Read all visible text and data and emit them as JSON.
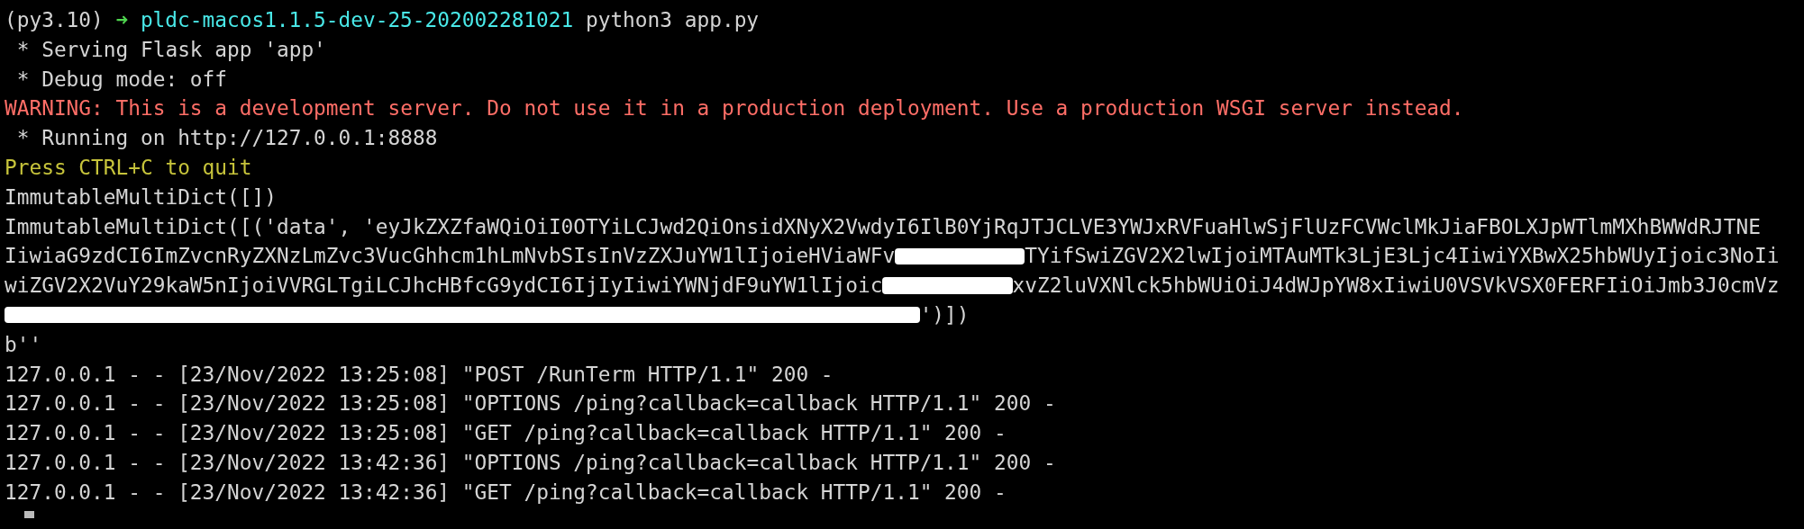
{
  "prompt": {
    "env": "(py3.10)",
    "arrow": "➜",
    "directory": "pldc-macos1.1.5-dev-25-202002281021",
    "command": "python3 app.py"
  },
  "lines": [
    {
      "kind": "info",
      "text": " * Serving Flask app 'app'"
    },
    {
      "kind": "info",
      "text": " * Debug mode: off"
    },
    {
      "kind": "warning",
      "text": "WARNING: This is a development server. Do not use it in a production deployment. Use a production WSGI server instead."
    },
    {
      "kind": "info",
      "text": " * Running on http://127.0.0.1:8888"
    },
    {
      "kind": "notice",
      "text": "Press CTRL+C to quit"
    },
    {
      "kind": "info",
      "text": "ImmutableMultiDict([])"
    },
    {
      "kind": "data",
      "segments": [
        {
          "text": "ImmutableMultiDict([('data', 'eyJkZXZfaWQiOiI0OTYiLCJwd2QiOnsidXNyX2VwdyI6IlB0YjRqJTJCLVE3YWJxRVFuaHlwSjFlUzFCVWclMkJiaFBOLXJpWTlmMXhBWWdRJTNE",
          "redacted_before": false
        }
      ]
    },
    {
      "kind": "data",
      "segments": [
        {
          "text": "IiwiaG9zdCI6ImZvcnRyZXNzLmZvc3VucGhhcm1hLmNvbSIsInVzZXJuYW1lIjoieHViaWFv",
          "redacted_before": false
        },
        {
          "text": "TYifSwiZGV2X2lwIjoiMTAuMTk3LjE3Ljc4IiwiYXBwX25hbWUyIjoic3NoIi",
          "redacted_before": true
        }
      ]
    },
    {
      "kind": "data",
      "segments": [
        {
          "text": "wiZGV2X2VuY29kaW5nIjoiVVRGLTgiLCJhcHBfcG9ydCI6IjIyIiwiYWNjdF9uYW1lIjoic",
          "redacted_before": false
        },
        {
          "text": "xvZ2luVXNlck5hbWUiOiJ4dWJpYW8xIiwiU0VSVkVSX0FERFIiOiJmb3J0cmVz",
          "redacted_before": true
        }
      ]
    },
    {
      "kind": "data",
      "segments": [
        {
          "text": "')])",
          "redacted_before": true
        }
      ]
    },
    {
      "kind": "info",
      "text": "b''"
    },
    {
      "kind": "info",
      "text": "127.0.0.1 - - [23/Nov/2022 13:25:08] \"POST /RunTerm HTTP/1.1\" 200 -"
    },
    {
      "kind": "info",
      "text": "127.0.0.1 - - [23/Nov/2022 13:25:08] \"OPTIONS /ping?callback=callback HTTP/1.1\" 200 -"
    },
    {
      "kind": "info",
      "text": "127.0.0.1 - - [23/Nov/2022 13:25:08] \"GET /ping?callback=callback HTTP/1.1\" 200 -"
    },
    {
      "kind": "info",
      "text": "127.0.0.1 - - [23/Nov/2022 13:42:36] \"OPTIONS /ping?callback=callback HTTP/1.1\" 200 -"
    },
    {
      "kind": "info",
      "text": "127.0.0.1 - - [23/Nov/2022 13:42:36] \"GET /ping?callback=callback HTTP/1.1\" 200 -"
    }
  ]
}
